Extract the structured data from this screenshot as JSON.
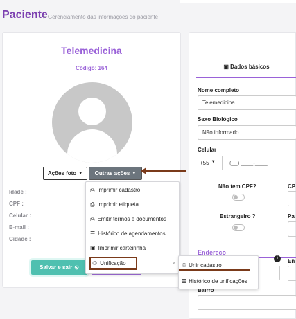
{
  "header": {
    "title": "Paciente",
    "breadcrumb": "> Gerenciamento das informações do paciente"
  },
  "patient": {
    "name": "Telemedicina",
    "code": "Código: 164"
  },
  "buttons": {
    "acoes_foto": "Ações foto",
    "outras_acoes": "Outras ações",
    "salvar_sair": "Salvar e sair"
  },
  "info_labels": [
    "Idade :",
    "CPF :",
    "Celular :",
    "E-mail :",
    "Cidade :"
  ],
  "dropdown": {
    "items": [
      {
        "icon": "printer-icon",
        "label": "Imprimir cadastro"
      },
      {
        "icon": "printer-icon",
        "label": "Imprimir etiqueta"
      },
      {
        "icon": "printer-icon",
        "label": "Emitir termos e documentos"
      },
      {
        "icon": "list-icon",
        "label": "Histórico de agendamentos"
      },
      {
        "icon": "id-card-icon",
        "label": "Imprimir carteirinha"
      },
      {
        "icon": "users-icon",
        "label": "Unificação"
      }
    ]
  },
  "submenu": {
    "items": [
      {
        "icon": "users-icon",
        "label": "Unir cadastro"
      },
      {
        "icon": "list-icon",
        "label": "Histórico de unificações"
      }
    ]
  },
  "form": {
    "tab_label": "Dados básicos",
    "nome_label": "Nome completo",
    "nome_value": "Telemedicina",
    "sexo_label": "Sexo Biológico",
    "sexo_value": "Não informado",
    "celular_label": "Celular",
    "ddi": "+55",
    "phone_placeholder": "(__) ____-____",
    "nao_tem_cpf": "Não tem CPF?",
    "cpf_short": "CP",
    "estrangeiro": "Estrangeiro ?",
    "pais_short": "Pa",
    "endereco": "Endereço",
    "end_short": "En",
    "bairro": "Bairro"
  },
  "colors": {
    "brand": "#7b3fb0",
    "accent": "#9a62d8",
    "success": "#4fc0b0",
    "annotation": "#7a3a1a"
  }
}
